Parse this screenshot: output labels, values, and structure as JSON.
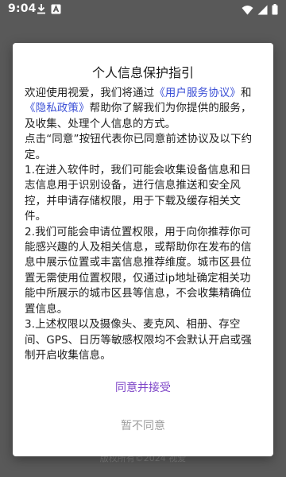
{
  "status_bar": {
    "time": "9:04",
    "left_icons": [
      "download-icon",
      "app-notification-icon"
    ],
    "right_icons": [
      "wifi-icon",
      "cellular-signal-icon",
      "battery-icon"
    ]
  },
  "backdrop": {
    "footer_text": "版权所有©2024 视爱"
  },
  "dialog": {
    "title": "个人信息保护指引",
    "intro_prefix": "欢迎使用视爱，我们将通过",
    "user_agreement_link": "《用户服务协议》",
    "intro_and": "和",
    "privacy_policy_link": "《隐私政策》",
    "intro_suffix": "帮助你了解我们为你提供的服务，及收集、处理个人信息的方式。",
    "consent_notice": "点击“同意”按钮代表你已同意前述协议及以下约定。",
    "clause_1": "1.在进入软件时，我们可能会收集设备信息和日志信息用于识别设备，进行信息推送和安全风控，并申请存储权限，用于下载及缓存相关文件。",
    "clause_2": "2.我们可能会申请位置权限，用于向你推荐你可能感兴趣的人及相关信息，或帮助你在发布的信息中展示位置或丰富信息推荐维度。城市区县位置无需使用位置权限，仅通过ip地址确定相关功能中所展示的城市区县等信息，不会收集精确位置信息。",
    "clause_3": "3.上述权限以及摄像头、麦克风、相册、存空间、GPS、日历等敏感权限均不会默认开启或强制开启收集信息。",
    "accept_label": "同意并接受",
    "decline_label": "暂不同意"
  },
  "colors": {
    "link": "#3b4fd6",
    "accept": "#7d43c7",
    "decline": "#9e9e9e",
    "overlay": "#595959"
  }
}
